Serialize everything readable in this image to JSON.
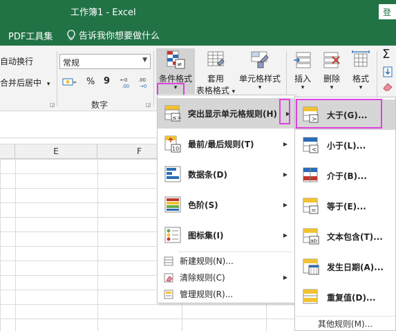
{
  "titlebar": {
    "title": "工作簿1  -  Excel",
    "login": "登"
  },
  "tabbar": {
    "pdf_tools": "PDF工具集",
    "tell_me": "告诉我你想要做什么"
  },
  "ribbon": {
    "wrap_text": "自动换行",
    "merge_center": "合并后居中",
    "merge_arrow": "▾",
    "number_format": "常规",
    "number_group": "数字",
    "percent": "%",
    "comma": "9",
    "cond_format": {
      "line1": "条件格式",
      "arrow": "▾"
    },
    "table_format": {
      "line1": "套用",
      "line2": "表格格式",
      "arrow": "▾"
    },
    "cell_style": {
      "line1": "单元格样式",
      "arrow": "▾"
    },
    "insert": {
      "label": "插入",
      "arrow": "▾"
    },
    "delete": {
      "label": "删除",
      "arrow": "▾"
    },
    "format": {
      "label": "格式",
      "arrow": "▾"
    }
  },
  "columns": [
    "E",
    "F"
  ],
  "menu": {
    "items": [
      {
        "label": "突出显示单元格规则(H)",
        "icon": "highlight-rules-icon"
      },
      {
        "label": "最前/最后规则(T)",
        "icon": "top-bottom-rules-icon"
      },
      {
        "label": "数据条(D)",
        "icon": "data-bars-icon"
      },
      {
        "label": "色阶(S)",
        "icon": "color-scales-icon"
      },
      {
        "label": "图标集(I)",
        "icon": "icon-sets-icon"
      }
    ],
    "small_items": [
      {
        "label": "新建规则(N)...",
        "icon": "new-rule-icon"
      },
      {
        "label": "清除规则(C)",
        "icon": "clear-rules-icon"
      },
      {
        "label": "管理规则(R)...",
        "icon": "manage-rules-icon"
      }
    ]
  },
  "submenu": {
    "items": [
      {
        "label": "大于(G)...",
        "icon": "greater-than-icon"
      },
      {
        "label": "小于(L)...",
        "icon": "less-than-icon"
      },
      {
        "label": "介于(B)...",
        "icon": "between-icon"
      },
      {
        "label": "等于(E)...",
        "icon": "equal-to-icon"
      },
      {
        "label": "文本包含(T)...",
        "icon": "text-contains-icon"
      },
      {
        "label": "发生日期(A)...",
        "icon": "date-occurring-icon"
      },
      {
        "label": "重复值(D)...",
        "icon": "duplicate-values-icon"
      }
    ],
    "more": "其他规则(M)..."
  },
  "colors": {
    "excel_green": "#217346",
    "highlight_pink": "#e040e0",
    "menu_hover": "#d6d6d6"
  }
}
